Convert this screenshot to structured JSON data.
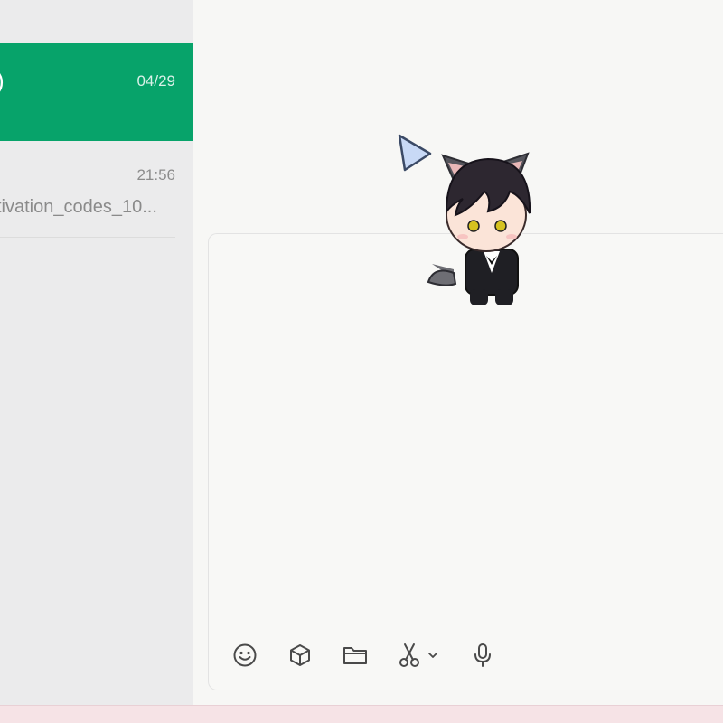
{
  "chat_list": {
    "items": [
      {
        "name_fragment": ")",
        "time": "04/29",
        "active": true
      },
      {
        "time": "21:56",
        "preview": "tivation_codes_10..."
      }
    ]
  },
  "composer": {
    "toolbar": [
      {
        "icon": "emoji-icon"
      },
      {
        "icon": "cube-icon"
      },
      {
        "icon": "folder-icon"
      },
      {
        "icon": "scissors-icon"
      },
      {
        "icon": "microphone-icon"
      }
    ]
  },
  "colors": {
    "accent": "#07a36a",
    "sidebar": "#ebebec",
    "main_bg": "#f7f7f5",
    "icon": "#4a4a4a"
  }
}
